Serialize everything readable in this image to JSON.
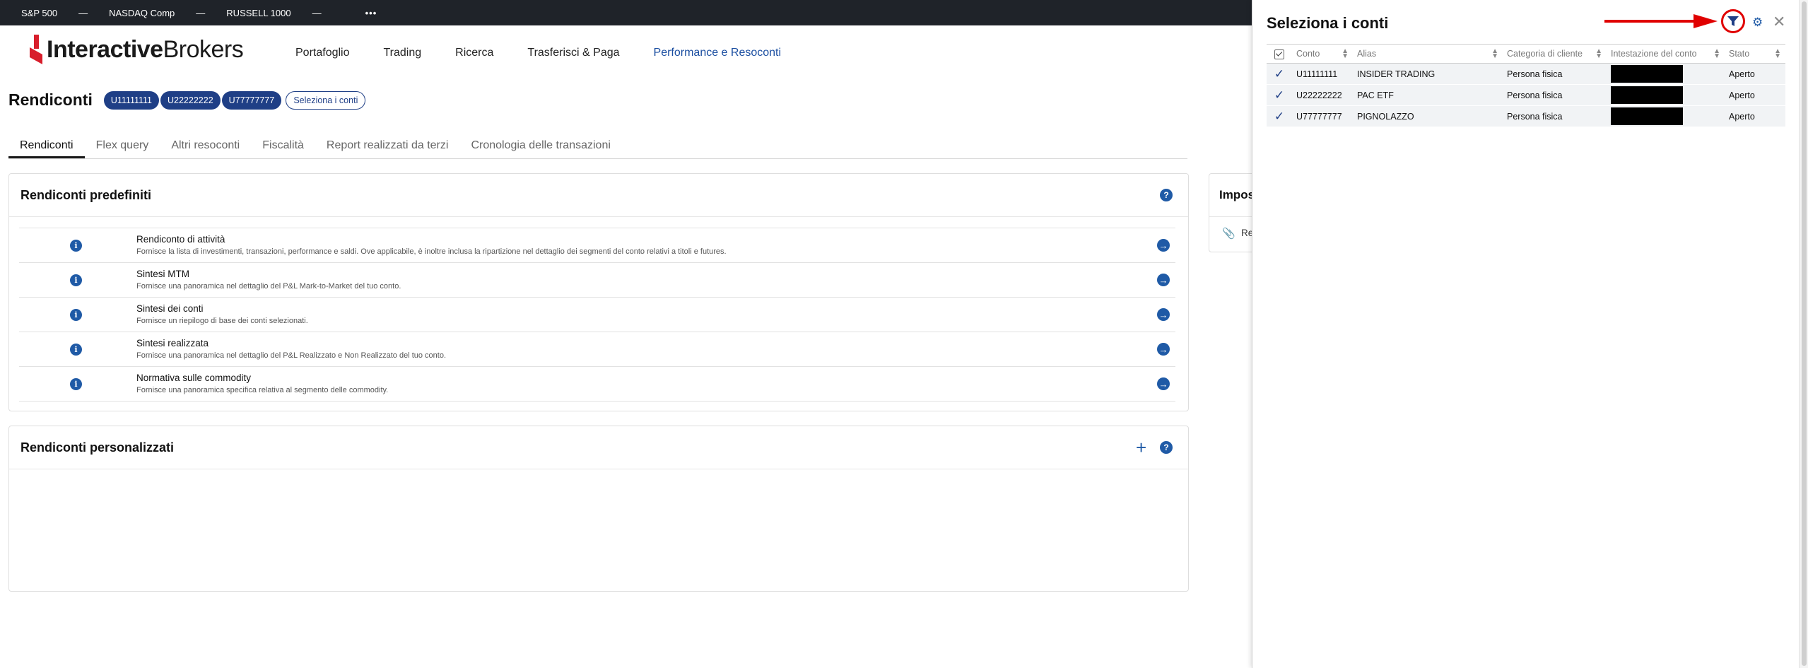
{
  "ticker": {
    "items": [
      {
        "name": "S&P 500",
        "value": "—"
      },
      {
        "name": "NASDAQ Comp",
        "value": "—"
      },
      {
        "name": "RUSSELL 1000",
        "value": "—"
      }
    ],
    "more": "•••"
  },
  "header": {
    "logo_part1": "Interactive",
    "logo_part2": "Brokers",
    "nav": [
      "Portafoglio",
      "Trading",
      "Ricerca",
      "Trasferisci & Paga",
      "Performance e Resoconti"
    ],
    "active_nav": "Performance e Resoconti"
  },
  "page": {
    "title": "Rendiconti",
    "accounts": [
      "U11111111",
      "U22222222",
      "U77777777"
    ],
    "select_accounts_label": "Seleziona i conti"
  },
  "tabs": [
    "Rendiconti",
    "Flex query",
    "Altri resoconti",
    "Fiscalità",
    "Report realizzati da terzi",
    "Cronologia delle transazioni"
  ],
  "predefined": {
    "title": "Rendiconti predefiniti",
    "help": "?",
    "reports": [
      {
        "name": "Rendiconto di attività",
        "desc": "Fornisce la lista di investimenti, transazioni, performance e saldi. Ove applicabile, è inoltre inclusa la ripartizione nel dettaglio dei segmenti del conto relativi a titoli e futures."
      },
      {
        "name": "Sintesi MTM",
        "desc": "Fornisce una panoramica nel dettaglio del P&L Mark-to-Market del tuo conto."
      },
      {
        "name": "Sintesi dei conti",
        "desc": "Fornisce un riepilogo di base dei conti selezionati."
      },
      {
        "name": "Sintesi realizzata",
        "desc": "Fornisce una panoramica nel dettaglio del P&L Realizzato e Non Realizzato del tuo conto."
      },
      {
        "name": "Normativa sulle commodity",
        "desc": "Fornisce una panoramica specifica relativa al segmento delle commodity."
      }
    ]
  },
  "custom": {
    "title": "Rendiconti personalizzati",
    "add": "+",
    "help": "?"
  },
  "side_card": {
    "title": "Impos",
    "item": "Re"
  },
  "panel": {
    "title": "Seleziona i conti",
    "columns": [
      "Conto",
      "Alias",
      "Categoria di cliente",
      "Intestazione del conto",
      "Stato"
    ],
    "rows": [
      {
        "account": "U11111111",
        "alias": "INSIDER TRADING",
        "category": "Persona fisica",
        "status": "Aperto"
      },
      {
        "account": "U22222222",
        "alias": "PAC ETF",
        "category": "Persona fisica",
        "status": "Aperto"
      },
      {
        "account": "U77777777",
        "alias": "PIGNOLAZZO",
        "category": "Persona fisica",
        "status": "Aperto"
      }
    ]
  },
  "colors": {
    "ticker_bg": "#1f2329",
    "brand_blue": "#1f3f86",
    "accent_blue": "#1f5aa6",
    "logo_red": "#d81e2c",
    "annotation_red": "#e00000"
  },
  "icons": [
    "info-icon",
    "arrow-right-icon",
    "help-icon",
    "plus-icon",
    "filter-icon",
    "gear-icon",
    "close-icon",
    "paperclip-icon",
    "check-icon",
    "sort-icon"
  ]
}
